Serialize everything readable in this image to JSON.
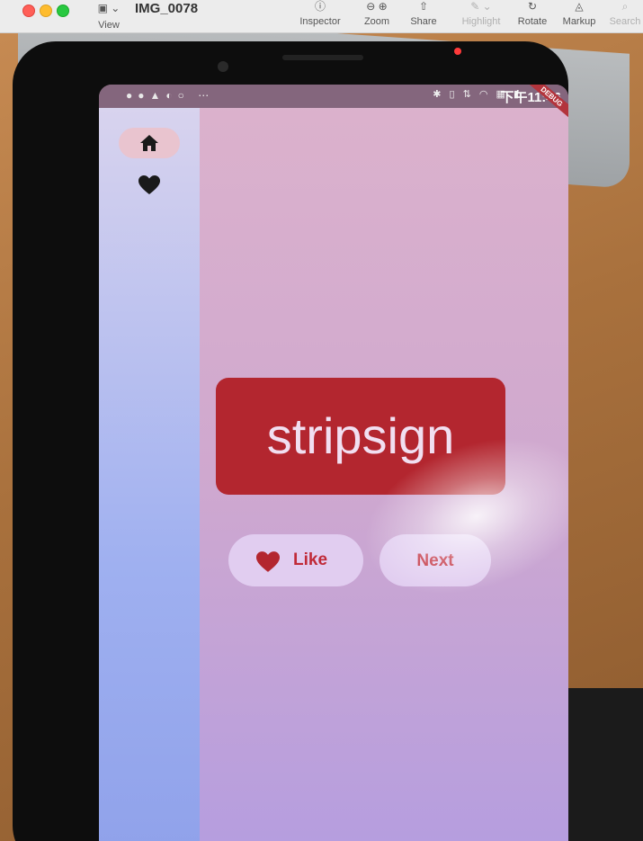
{
  "window": {
    "title": "IMG_0078",
    "view_label": "View"
  },
  "toolbar": {
    "items": [
      {
        "label": "Inspector",
        "icon": "info-icon",
        "enabled": true
      },
      {
        "label": "Zoom",
        "icon": "zoom-icon",
        "enabled": true
      },
      {
        "label": "Share",
        "icon": "share-icon",
        "enabled": true
      },
      {
        "label": "Highlight",
        "icon": "highlight-pen-icon",
        "enabled": false
      },
      {
        "label": "Rotate",
        "icon": "rotate-icon",
        "enabled": true
      },
      {
        "label": "Markup",
        "icon": "markup-icon",
        "enabled": true
      },
      {
        "label": "Search",
        "icon": "search-icon",
        "enabled": false
      }
    ]
  },
  "phone": {
    "status_bar": {
      "time": "下午11:46",
      "banner": "DEBUG"
    },
    "app": {
      "rail": {
        "home_icon": "home-icon",
        "favorites_icon": "heart-icon",
        "selected": "home"
      },
      "word": "stripsign",
      "like_label": "Like",
      "next_label": "Next",
      "colors": {
        "card": "#b3262f",
        "accent": "#c02a38",
        "rail": "#9fb0f0",
        "background": "#cfa8cf"
      }
    }
  }
}
